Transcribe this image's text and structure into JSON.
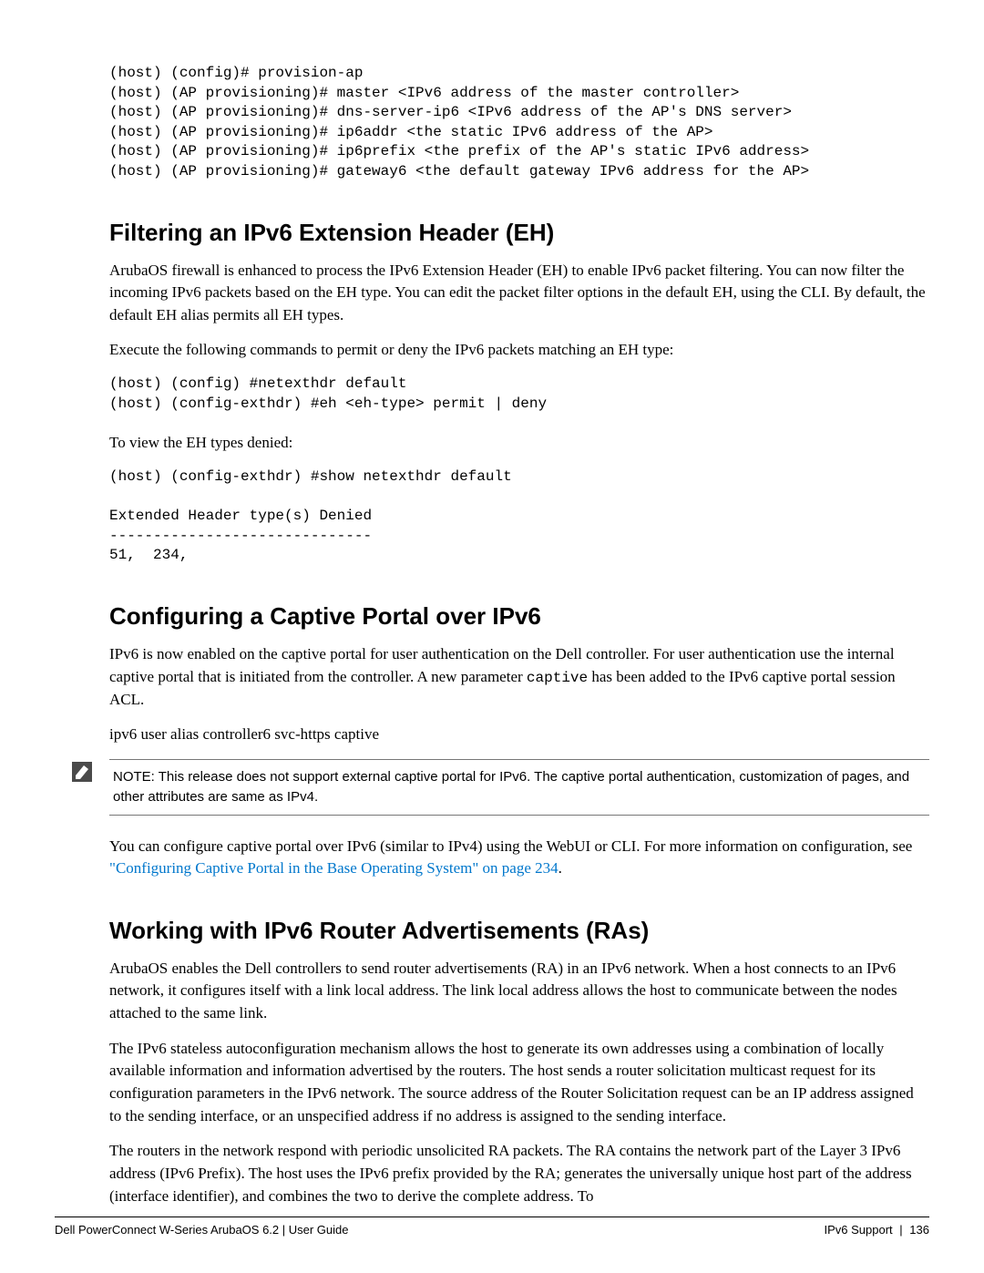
{
  "code_block_1": "(host) (config)# provision-ap\n(host) (AP provisioning)# master <IPv6 address of the master controller>\n(host) (AP provisioning)# dns-server-ip6 <IPv6 address of the AP's DNS server>\n(host) (AP provisioning)# ip6addr <the static IPv6 address of the AP>\n(host) (AP provisioning)# ip6prefix <the prefix of the AP's static IPv6 address>\n(host) (AP provisioning)# gateway6 <the default gateway IPv6 address for the AP>",
  "section1": {
    "title": "Filtering an IPv6 Extension Header (EH)",
    "para1": "ArubaOS firewall is enhanced to process the IPv6 Extension Header (EH) to enable IPv6 packet filtering. You can now filter the incoming IPv6 packets based on the EH type. You can edit the packet filter options in the default EH, using the CLI. By default, the default EH alias permits all EH types.",
    "para2": "Execute the following commands to permit or deny the IPv6 packets matching an EH type:",
    "code1": "(host) (config) #netexthdr default\n(host) (config-exthdr) #eh <eh-type> permit | deny",
    "para3": "To view the EH types denied:",
    "code2": "(host) (config-exthdr) #show netexthdr default\n\nExtended Header type(s) Denied\n------------------------------\n51,  234,"
  },
  "section2": {
    "title": "Configuring a Captive Portal over IPv6",
    "para1_a": "IPv6 is now enabled on the captive portal for user authentication on the Dell  controller. For user authentication use the internal captive portal that is initiated from the controller. A new parameter ",
    "para1_code": "captive",
    "para1_b": " has been added to the IPv6 captive portal session ACL.",
    "para2": "ipv6 user alias controller6 svc-https captive",
    "note": "NOTE: This release does not support external captive portal for IPv6. The captive portal authentication, customization of pages, and other attributes are same as IPv4.",
    "para3_a": "You can configure captive portal over IPv6 (similar to IPv4) using the WebUI or CLI. For more information on configuration, see ",
    "link": "\"Configuring Captive Portal in the Base Operating System\" on page 234",
    "para3_b": "."
  },
  "section3": {
    "title": "Working with IPv6 Router Advertisements (RAs)",
    "para1": "ArubaOS enables the Dell controllers to send router advertisements (RA) in an IPv6 network. When a host connects to an IPv6 network, it configures itself with a link local address. The link local address allows the host to communicate between the nodes attached to the same link.",
    "para2": "The IPv6 stateless autoconfiguration mechanism allows the host to generate its own addresses using a combination of locally available information and information advertised by the routers. The host sends a router solicitation multicast request for its configuration parameters in the IPv6 network. The source address of the Router Solicitation request can be an IP address assigned to the sending interface, or an unspecified address if no address is assigned to the sending interface.",
    "para3": "The routers in the network respond with periodic unsolicited RA packets. The RA contains the network part of the Layer 3 IPv6 address (IPv6 Prefix). The host uses the IPv6 prefix provided by the RA; generates the universally unique host part of the address (interface identifier), and combines the two to derive the complete address. To"
  },
  "footer": {
    "left": "Dell PowerConnect W-Series ArubaOS 6.2  |  User Guide",
    "right_section": "IPv6 Support",
    "right_page": "136"
  }
}
